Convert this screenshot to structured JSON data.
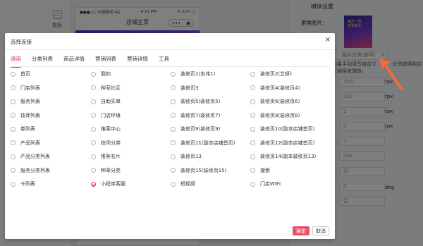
{
  "background": {
    "left_nav": {
      "label": "模板",
      "icon": "template-icon"
    },
    "phone": {
      "carrier": "●●●○○ 中国移动 4G",
      "time": "4:21 PM",
      "battery": "✈ 22% ▭",
      "title": "店铺主页",
      "capsule_dots": "•••",
      "capsule_target": "◉"
    },
    "right_panel": {
      "title": "模块设置",
      "replace_label": "更换图片:",
      "thumb_text": "每户一张\n惊喜套礼",
      "link_value": "服务分类(美甲/",
      "hint_line1": "如果手动填写自定义",
      "hint_line2": "义链接来跳转。",
      "hint_right": "优先按照自定",
      "fields": [
        {
          "value": "750",
          "unit": "rpx"
        },
        {
          "value": "810",
          "unit": "rpx"
        },
        {
          "value": "2",
          "unit": "rpx"
        },
        {
          "value": "0",
          "unit": "rpx"
        },
        {
          "value": "1",
          "unit": ""
        },
        {
          "value": "0px",
          "unit": ""
        },
        {
          "value": "否",
          "unit": ""
        },
        {
          "value": "0",
          "unit": "deg"
        },
        {
          "value": "否",
          "unit": ""
        }
      ]
    }
  },
  "modal": {
    "title": "选择连接",
    "close": "×",
    "tabs": [
      {
        "label": "通用",
        "active": true
      },
      {
        "label": "分类列表",
        "active": false
      },
      {
        "label": "商品详情",
        "active": false
      },
      {
        "label": "营销列表",
        "active": false
      },
      {
        "label": "营销详情",
        "active": false
      },
      {
        "label": "工具",
        "active": false
      }
    ],
    "columns": [
      [
        "首页",
        "门店列表",
        "服务列表",
        "技师列表",
        "券列表",
        "产品列表",
        "产品分类列表",
        "服务分类列表",
        "卡列表"
      ],
      [
        "我的",
        "种草社区",
        "自助买单",
        "门店环境",
        "推客中心",
        "技师分类",
        "推客名片",
        "种草分类",
        "小程序客服"
      ],
      [
        "装修页1(志伟1)",
        "装修页3",
        "装修页5(装修页5)",
        "装修页7(装修页7)",
        "装修页9(装修页9)",
        "装修页11(副本店铺首页)",
        "装修页13",
        "装修页15(装修页15)",
        "短视频"
      ],
      [
        "装修页2(艾妍)",
        "装修页4(装修页4)",
        "装修页6(装修页6)",
        "装修页8(装修页8)",
        "装修页10(副本店铺首页)",
        "装修页12(副本店铺首页)",
        "装修页14(副本装修页13)",
        "搜索",
        "门店WIFI"
      ]
    ],
    "selected": "小程序客服",
    "ok_label": "确定",
    "cancel_label": "取消"
  },
  "colors": {
    "accent": "#e83a4f",
    "arrow": "#f06a3c"
  }
}
